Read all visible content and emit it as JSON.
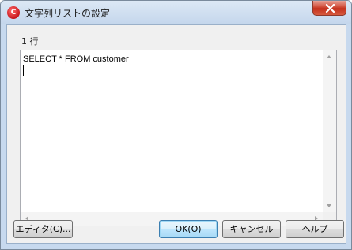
{
  "window": {
    "title": "文字列リストの設定",
    "app_icon_glyph": "C"
  },
  "editor": {
    "line_label": "1 行",
    "text": "SELECT * FROM customer"
  },
  "buttons": {
    "edit": "エディタ(C)...",
    "ok": "OK(O)",
    "cancel": "キャンセル",
    "help": "ヘルプ"
  },
  "colors": {
    "close_button": "#c4301c",
    "ok_border": "#3c7fb1"
  }
}
